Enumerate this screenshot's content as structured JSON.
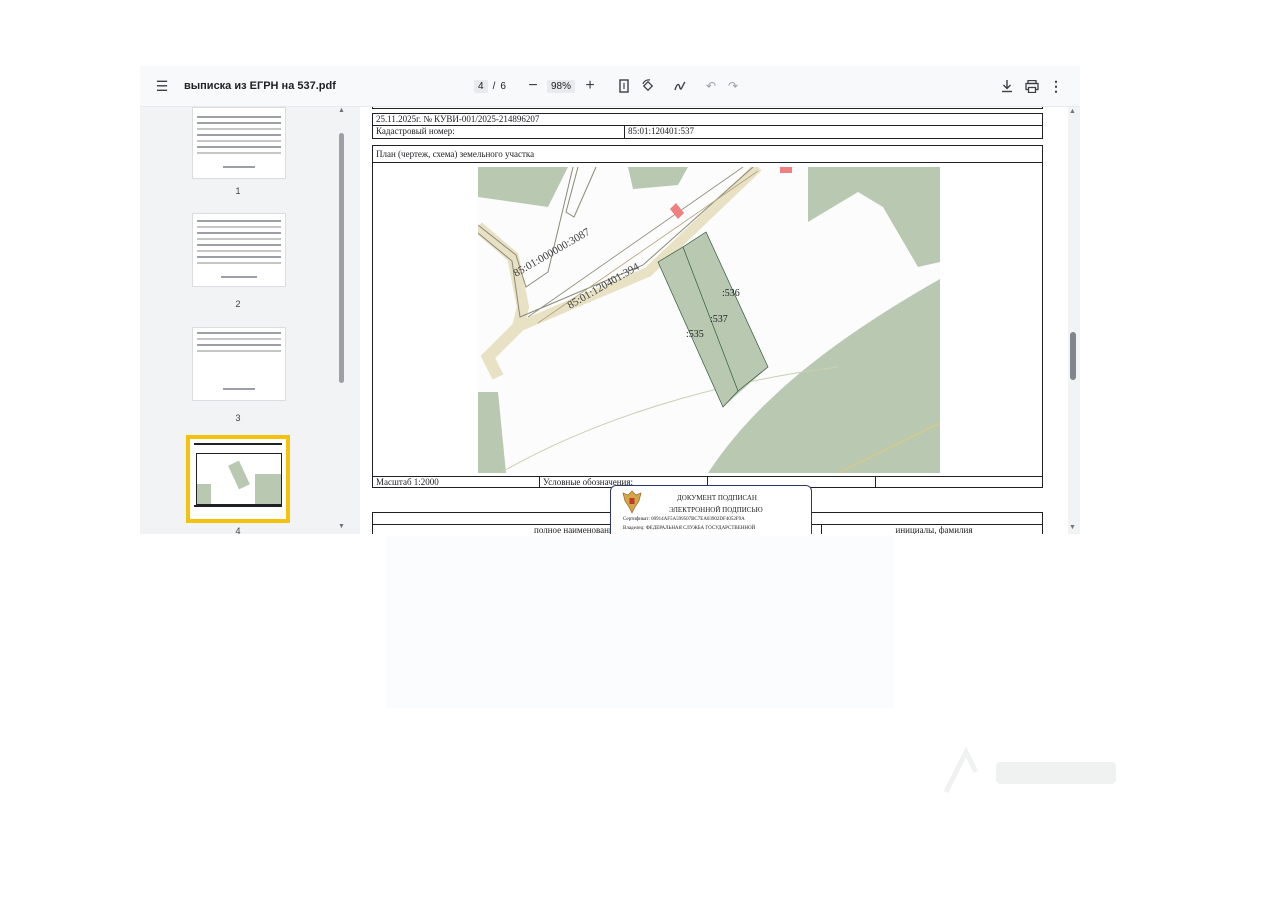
{
  "toolbar": {
    "menu_icon": "hamburger-menu-icon",
    "file_name": "выписка из ЕГРН на 537.pdf",
    "current_page": "4",
    "page_separator": "/",
    "total_pages": "6",
    "zoom_out_symbol": "−",
    "zoom_level": "98%",
    "zoom_in_symbol": "+"
  },
  "sidebar": {
    "thumbnails": [
      {
        "label": "1"
      },
      {
        "label": "2"
      },
      {
        "label": "3"
      },
      {
        "label": "4",
        "selected": true
      }
    ]
  },
  "document": {
    "header_line": "25.11.2025г. № КУВИ-001/2025-214896207",
    "cadastral_label": "Кадастровый номер:",
    "cadastral_value": "85:01:120401:537",
    "plan_title": "План (чертеж, схема) земельного участка",
    "map_labels": {
      "road1": "85:01:000000:3087",
      "road2": "85:01:120401:394",
      "parcel_536": ":536",
      "parcel_537": ":537",
      "parcel_535": ":535"
    },
    "scale": "Масштаб 1:2000",
    "legend": "Условные обозначения:",
    "position_label": "полное наименование должности",
    "initials_label": "инициалы, фамилия",
    "stamp": {
      "line1": "ДОКУМЕНТ ПОДПИСАН",
      "line2": "ЭЛЕКТРОННОЙ ПОДПИСЬЮ",
      "cert": "Сертификат: 00914AF5A599507BC7EA03902DF4052F9A",
      "owner": "Владелец: ФЕДЕРАЛЬНАЯ СЛУЖБА ГОСУДАРСТВЕННОЙ"
    }
  },
  "colors": {
    "toolbar_bg": "#f8f9fa",
    "sidebar_bg": "#f1f3f4",
    "selection": "#f4c20d",
    "parcel_green": "#b9c9b1",
    "road": "#ece3c5",
    "stamp_border": "#2b3a6a"
  }
}
